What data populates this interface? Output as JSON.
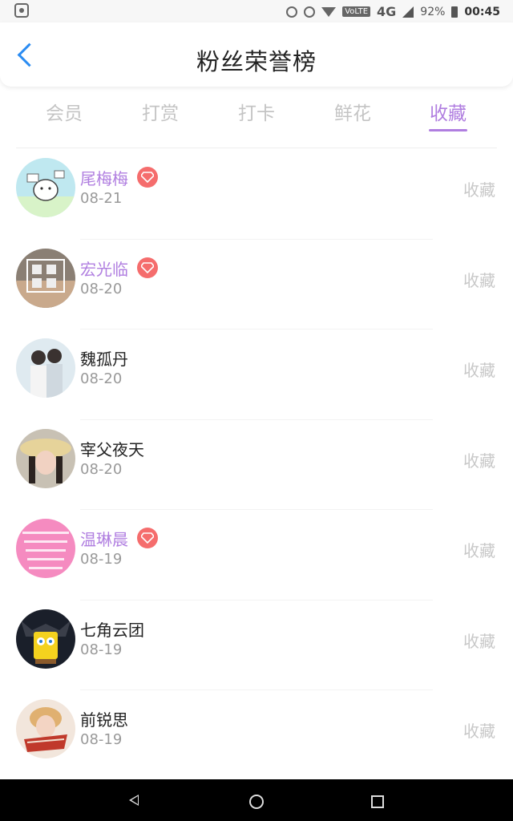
{
  "status_bar": {
    "network_badge": "VoLTE",
    "network_type": "4G",
    "battery": "92%",
    "time": "00:45"
  },
  "header": {
    "title": "粉丝荣誉榜",
    "back_icon": "chevron-left-icon"
  },
  "tabs": [
    {
      "label": "会员",
      "active": false
    },
    {
      "label": "打赏",
      "active": false
    },
    {
      "label": "打卡",
      "active": false
    },
    {
      "label": "鲜花",
      "active": false
    },
    {
      "label": "收藏",
      "active": true
    }
  ],
  "colors": {
    "accent": "#b07ee0",
    "back_icon": "#2b8cf2",
    "vip_badge": "#f56d6d",
    "muted": "#c8c8c8"
  },
  "fans": [
    {
      "name": "尾梅梅",
      "date": "08-21",
      "vip": true,
      "action": "收藏",
      "avatar": "cartoon-bird"
    },
    {
      "name": "宏光临",
      "date": "08-20",
      "vip": true,
      "action": "收藏",
      "avatar": "text-photo-bw"
    },
    {
      "name": "魏孤丹",
      "date": "08-20",
      "vip": false,
      "action": "收藏",
      "avatar": "couple-photo"
    },
    {
      "name": "宰父夜天",
      "date": "08-20",
      "vip": false,
      "action": "收藏",
      "avatar": "girl-with-hat"
    },
    {
      "name": "温琳晨",
      "date": "08-19",
      "vip": true,
      "action": "收藏",
      "avatar": "pink-text-card"
    },
    {
      "name": "七角云团",
      "date": "08-19",
      "vip": false,
      "action": "收藏",
      "avatar": "spongebob-batman"
    },
    {
      "name": "前锐思",
      "date": "08-19",
      "vip": false,
      "action": "收藏",
      "avatar": "person-red-scarf"
    }
  ],
  "nav_bar": {
    "back_icon": "triangle-back-icon",
    "home_icon": "circle-home-icon",
    "recent_icon": "square-recent-icon"
  }
}
